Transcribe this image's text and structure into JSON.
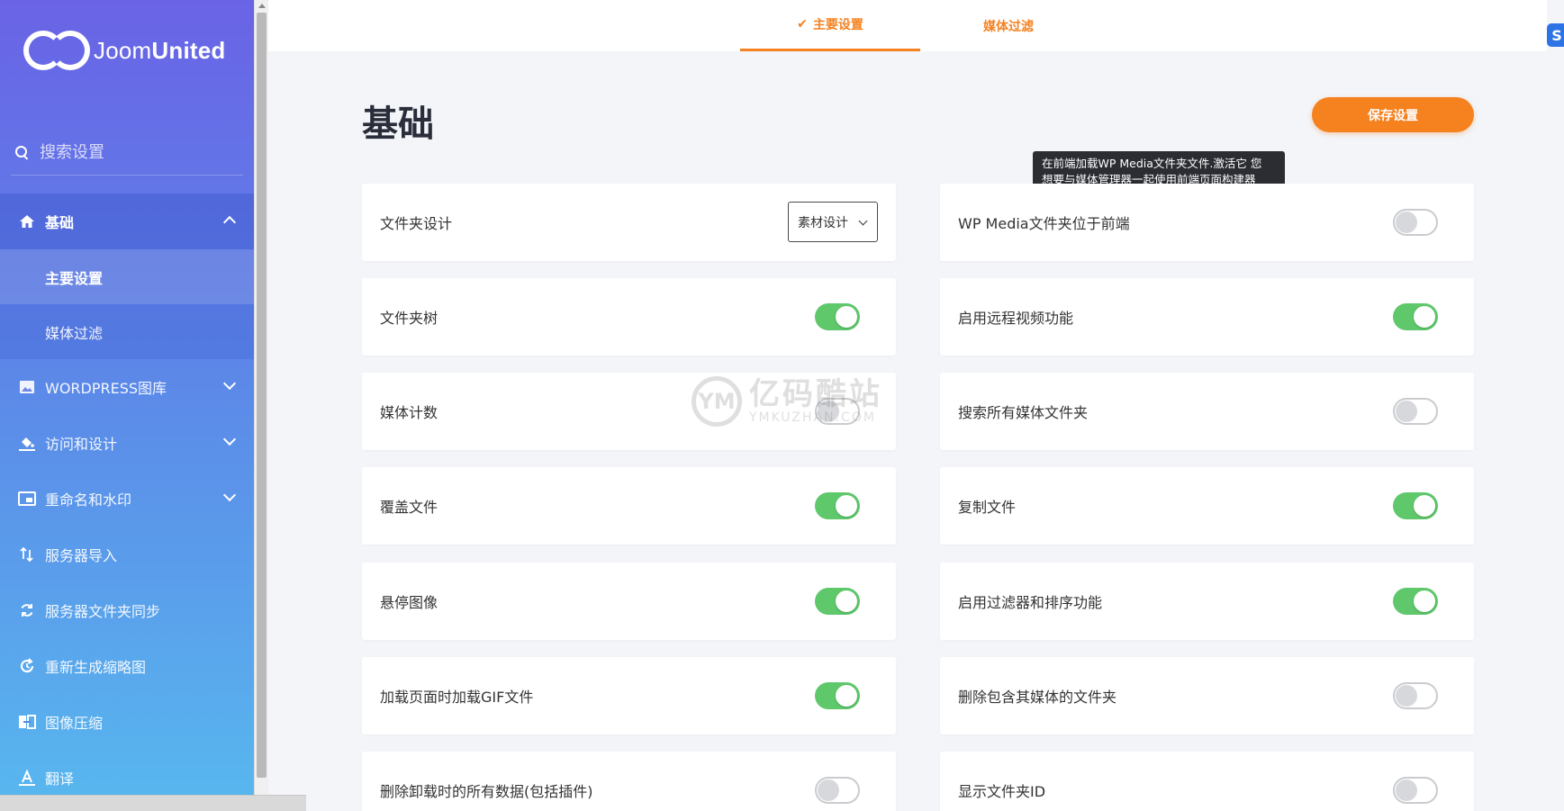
{
  "logo": {
    "light": "Joom",
    "bold": "United"
  },
  "search": {
    "placeholder": "搜索设置"
  },
  "sidebar": {
    "items": [
      {
        "label": "基础",
        "icon": "home-icon"
      },
      {
        "label": "WORDPRESS图库",
        "icon": "image-icon"
      },
      {
        "label": "访问和设计",
        "icon": "paint-bucket-icon"
      },
      {
        "label": "重命名和水印",
        "icon": "watermark-icon"
      },
      {
        "label": "服务器导入",
        "icon": "import-arrows-icon"
      },
      {
        "label": "服务器文件夹同步",
        "icon": "sync-icon"
      },
      {
        "label": "重新生成缩略图",
        "icon": "regenerate-icon"
      },
      {
        "label": "图像压缩",
        "icon": "compress-icon"
      },
      {
        "label": "翻译",
        "icon": "translate-icon"
      }
    ],
    "sub_items": [
      "主要设置",
      "媒体过滤"
    ]
  },
  "tabs": {
    "main": "主要设置",
    "media": "媒体过滤"
  },
  "page": {
    "title": "基础",
    "save": "保存设置"
  },
  "tooltip": {
    "line1": "在前端加载WP Media文件夹文件.激活它 您",
    "line2": "想要与媒体管理器一起使用前端页面构建器"
  },
  "settings": {
    "left": [
      {
        "label": "文件夹设计",
        "type": "select",
        "value": "素材设计"
      },
      {
        "label": "文件夹树",
        "on": true
      },
      {
        "label": "媒体计数",
        "on": false
      },
      {
        "label": "覆盖文件",
        "on": true
      },
      {
        "label": "悬停图像",
        "on": true
      },
      {
        "label": "加载页面时加载GIF文件",
        "on": true
      },
      {
        "label": "删除卸载时的所有数据(包括插件)",
        "on": false
      }
    ],
    "right": [
      {
        "label": "WP Media文件夹位于前端",
        "on": false
      },
      {
        "label": "启用远程视频功能",
        "on": true
      },
      {
        "label": "搜索所有媒体文件夹",
        "on": false
      },
      {
        "label": "复制文件",
        "on": true
      },
      {
        "label": "启用过滤器和排序功能",
        "on": true
      },
      {
        "label": "删除包含其媒体的文件夹",
        "on": false
      },
      {
        "label": "显示文件夹ID",
        "on": false
      }
    ]
  },
  "watermark": {
    "cn": "亿码酷站",
    "en": "YMKUZHAN.COM"
  },
  "colors": {
    "accent": "#f5811f",
    "toggle_on": "#5ec86b"
  }
}
